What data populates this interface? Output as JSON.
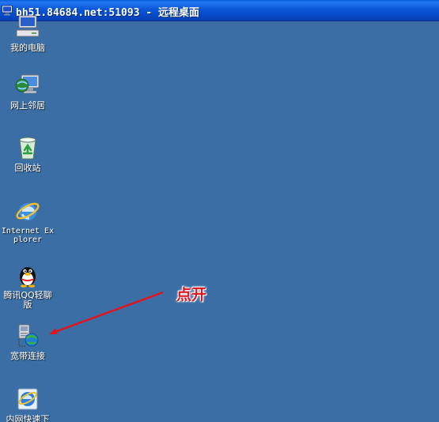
{
  "window": {
    "title": "bh51.84684.net:51093 - 远程桌面",
    "icon": "remote-desktop-icon"
  },
  "desktop": {
    "background_color": "#3a6ea5",
    "icons": [
      {
        "label": "我的电脑",
        "icon": "computer-icon"
      },
      {
        "label": "网上邻居",
        "icon": "network-places-icon"
      },
      {
        "label": "回收站",
        "icon": "recycle-bin-icon"
      },
      {
        "label": "Internet Explorer",
        "icon": "internet-explorer-icon"
      },
      {
        "label": "腾讯QQ轻聊版",
        "icon": "qq-penguin-icon"
      },
      {
        "label": "宽带连接",
        "icon": "broadband-connection-icon"
      },
      {
        "label": "内网快速下",
        "icon": "intranet-download-icon"
      }
    ]
  },
  "annotation": {
    "text": "点开",
    "color": "#e0141e",
    "target": "宽带连接"
  }
}
